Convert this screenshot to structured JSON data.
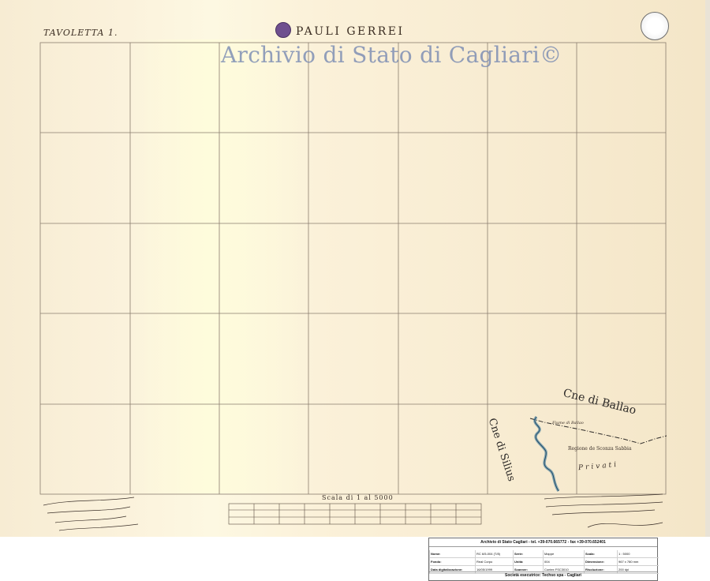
{
  "map": {
    "tavoletta": "TAVOLETTA 1.",
    "title": "PAULI GERREI",
    "watermark": "Archivio di Stato di Cagliari©",
    "labels": {
      "cantone_ballao": "Cne di Ballao",
      "cantone_silius": "Cne di Silius",
      "privati": "Privati",
      "regione": "Regione de Sconza Sabbia",
      "fiume": "Fiume di Ballao"
    },
    "scale_label": "Scala di 1 al 5000"
  },
  "info_panel": {
    "header": "Archivio di Stato Cagliari - tel. +39-070.665772 - fax +39-070.652401",
    "fields": [
      {
        "label": "Nome:",
        "value": "RC 6/5-004 (T/8)"
      },
      {
        "label": "Serie:",
        "value": "Mappe"
      },
      {
        "label": "Scala:",
        "value": "1 : 5000"
      },
      {
        "label": "Fondo:",
        "value": "Real Corpo"
      },
      {
        "label": "Unità:",
        "value": "004"
      },
      {
        "label": "Dimensione:",
        "value": "967 x 780 mm"
      },
      {
        "label": "Data digitalizzazione:",
        "value": "16/05/1999"
      },
      {
        "label": "Scanner:",
        "value": "Contex FSC3010"
      },
      {
        "label": "Risoluzione:",
        "value": "200 dpi"
      }
    ],
    "footer": "Società esecutrice: Techso spa - Cagliari"
  }
}
